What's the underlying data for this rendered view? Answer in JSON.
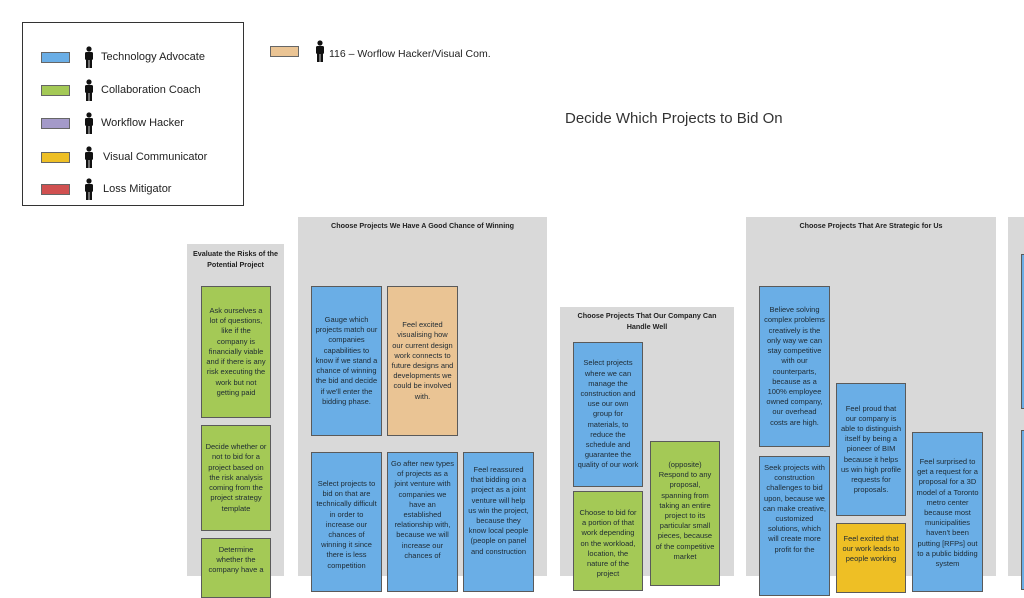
{
  "legend": {
    "items": [
      {
        "label": "Technology Advocate",
        "color": "#6aaee6",
        "icon": "person-icon"
      },
      {
        "label": "Collaboration Coach",
        "color": "#a4c956",
        "icon": "person-icon"
      },
      {
        "label": "Workflow Hacker",
        "color": "#a49ac9",
        "icon": "person-icon"
      },
      {
        "label": "Visual Communicator",
        "color": "#eebf25",
        "icon": "person-icon"
      },
      {
        "label": "Loss Mitigator",
        "color": "#d05050",
        "icon": "person-icon"
      }
    ],
    "extra": {
      "label": "116 – Worflow Hacker/Visual Com.",
      "color": "#eac494",
      "icon": "person-icon"
    }
  },
  "title": "Decide Which Projects to Bid On",
  "columns": [
    {
      "title": "Evaluate the Risks of the Potential Project",
      "cards": [
        {
          "text": "Ask ourselves a lot of questions, like if the company is financially viable and if there is any risk executing the work but not getting paid",
          "color": "green"
        },
        {
          "text": "Decide whether or not to bid for a project based on the risk analysis coming from the project strategy template",
          "color": "green"
        },
        {
          "text": "Determine whether the company have a",
          "color": "green"
        }
      ]
    },
    {
      "title": "Choose Projects We Have A Good Chance of Winning",
      "cards": [
        {
          "text": "Gauge which projects match our companies capabilities to know if we stand a chance of winning the bid and decide if we'll enter the bidding phase.",
          "color": "blue"
        },
        {
          "text": "Feel excited visualising how our current design work connects to future designs and developments we could be involved with.",
          "color": "tan"
        },
        {
          "text": "Select projects to bid on that are technically difficult in order to increase our chances of winning it since there is less competition",
          "color": "blue"
        },
        {
          "text": "Go after new types of projects as a joint venture with companies we have an established relationship with, because we will increase our chances of",
          "color": "blue"
        },
        {
          "text": "Feel reassured that bidding on a project as a joint venture will help us win the project, because they know local people (people on panel and construction",
          "color": "blue"
        }
      ]
    },
    {
      "title": "Choose Projects That Our Company Can Handle Well",
      "cards": [
        {
          "text": "Select projects where we can manage the construction and use our own group for materials, to reduce the schedule and guarantee the quality of our work",
          "color": "blue"
        },
        {
          "text": "(opposite) Respond to any proposal, spanning from taking an entire project to its particular small pieces, because of the competitive market",
          "color": "green"
        },
        {
          "text": "Choose to bid for a portion of that work depending on the workload, location, the nature of the project",
          "color": "green"
        }
      ]
    },
    {
      "title": "Choose Projects That Are Strategic for Us",
      "cards": [
        {
          "text": "Believe solving complex problems creatively is the only way we can stay competitive with our counterparts, because as a 100% employee owned company, our overhead costs are high.",
          "color": "blue"
        },
        {
          "text": "Feel proud that our company is able to distinguish itself by being a pioneer of BIM because it helps us win high profile requests for proposals.",
          "color": "blue"
        },
        {
          "text": "Feel surprised to get a request for a proposal for a 3D model of a Toronto metro center because most municipalities haven't been putting [RFPs] out to a public bidding system",
          "color": "blue"
        },
        {
          "text": "Seek projects with construction challenges to bid upon, because we can make creative, customized solutions, which will create more profit for the",
          "color": "blue"
        },
        {
          "text": "Feel excited that our work leads to people working",
          "color": "yellow"
        }
      ]
    }
  ]
}
